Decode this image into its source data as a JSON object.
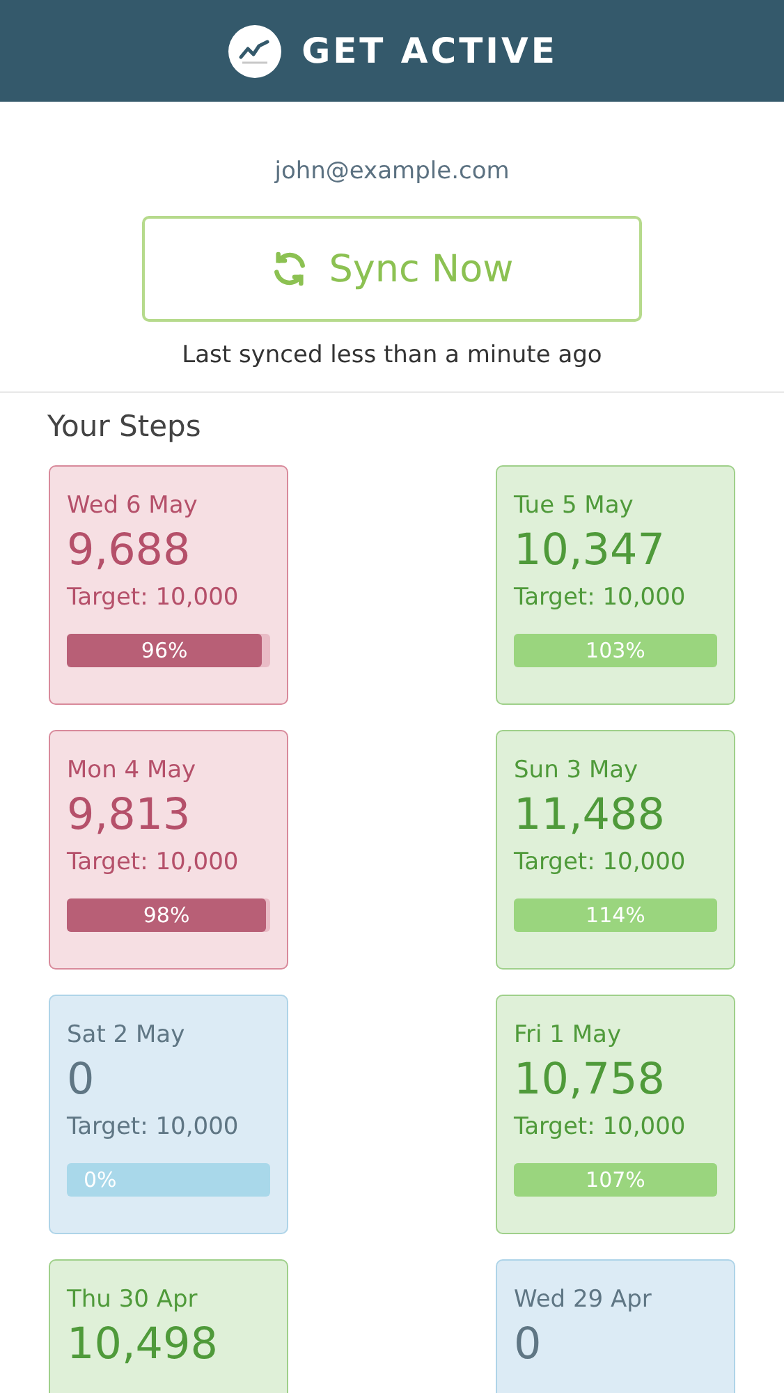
{
  "header": {
    "title": "GET ACTIVE"
  },
  "account": {
    "email": "john@example.com"
  },
  "sync": {
    "button": "Sync Now",
    "status": "Last synced less than a minute ago"
  },
  "steps": {
    "title": "Your Steps",
    "days": [
      {
        "date": "Wed 6 May",
        "steps": "9,688",
        "target": "Target: 10,000",
        "kind": "below",
        "level": 0.96,
        "percent": "96%"
      },
      {
        "date": "Tue 5 May",
        "steps": "10,347",
        "target": "Target: 10,000",
        "kind": "met",
        "level": 1,
        "percent": "103%"
      },
      {
        "date": "Mon 4 May",
        "steps": "9,813",
        "target": "Target: 10,000",
        "kind": "below",
        "level": 0.98,
        "percent": "98%"
      },
      {
        "date": "Sun 3 May",
        "steps": "11,488",
        "target": "Target: 10,000",
        "kind": "met",
        "level": 1,
        "percent": "114%"
      },
      {
        "date": "Sat 2 May",
        "steps": "0",
        "target": "Target: 10,000",
        "kind": "none",
        "level": 0,
        "percent": "0%"
      },
      {
        "date": "Fri 1 May",
        "steps": "10,758",
        "target": "Target: 10,000",
        "kind": "met",
        "level": 1,
        "percent": "107%"
      },
      {
        "date": "Thu 30 Apr",
        "steps": "10,498",
        "kind": "met"
      },
      {
        "date": "Wed 29 Apr",
        "steps": "0",
        "kind": "none"
      }
    ]
  }
}
